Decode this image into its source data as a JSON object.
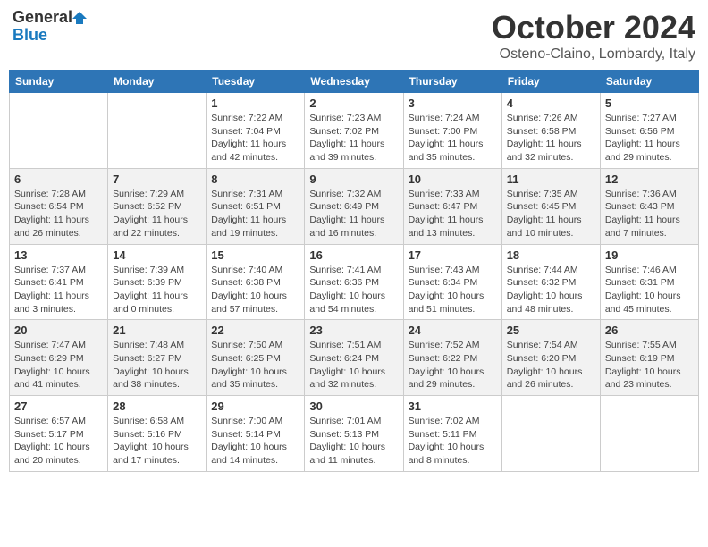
{
  "header": {
    "logo_line1": "General",
    "logo_line2": "Blue",
    "title": "October 2024",
    "location": "Osteno-Claino, Lombardy, Italy"
  },
  "days_of_week": [
    "Sunday",
    "Monday",
    "Tuesday",
    "Wednesday",
    "Thursday",
    "Friday",
    "Saturday"
  ],
  "weeks": [
    [
      {
        "day": "",
        "info": ""
      },
      {
        "day": "",
        "info": ""
      },
      {
        "day": "1",
        "info": "Sunrise: 7:22 AM\nSunset: 7:04 PM\nDaylight: 11 hours and 42 minutes."
      },
      {
        "day": "2",
        "info": "Sunrise: 7:23 AM\nSunset: 7:02 PM\nDaylight: 11 hours and 39 minutes."
      },
      {
        "day": "3",
        "info": "Sunrise: 7:24 AM\nSunset: 7:00 PM\nDaylight: 11 hours and 35 minutes."
      },
      {
        "day": "4",
        "info": "Sunrise: 7:26 AM\nSunset: 6:58 PM\nDaylight: 11 hours and 32 minutes."
      },
      {
        "day": "5",
        "info": "Sunrise: 7:27 AM\nSunset: 6:56 PM\nDaylight: 11 hours and 29 minutes."
      }
    ],
    [
      {
        "day": "6",
        "info": "Sunrise: 7:28 AM\nSunset: 6:54 PM\nDaylight: 11 hours and 26 minutes."
      },
      {
        "day": "7",
        "info": "Sunrise: 7:29 AM\nSunset: 6:52 PM\nDaylight: 11 hours and 22 minutes."
      },
      {
        "day": "8",
        "info": "Sunrise: 7:31 AM\nSunset: 6:51 PM\nDaylight: 11 hours and 19 minutes."
      },
      {
        "day": "9",
        "info": "Sunrise: 7:32 AM\nSunset: 6:49 PM\nDaylight: 11 hours and 16 minutes."
      },
      {
        "day": "10",
        "info": "Sunrise: 7:33 AM\nSunset: 6:47 PM\nDaylight: 11 hours and 13 minutes."
      },
      {
        "day": "11",
        "info": "Sunrise: 7:35 AM\nSunset: 6:45 PM\nDaylight: 11 hours and 10 minutes."
      },
      {
        "day": "12",
        "info": "Sunrise: 7:36 AM\nSunset: 6:43 PM\nDaylight: 11 hours and 7 minutes."
      }
    ],
    [
      {
        "day": "13",
        "info": "Sunrise: 7:37 AM\nSunset: 6:41 PM\nDaylight: 11 hours and 3 minutes."
      },
      {
        "day": "14",
        "info": "Sunrise: 7:39 AM\nSunset: 6:39 PM\nDaylight: 11 hours and 0 minutes."
      },
      {
        "day": "15",
        "info": "Sunrise: 7:40 AM\nSunset: 6:38 PM\nDaylight: 10 hours and 57 minutes."
      },
      {
        "day": "16",
        "info": "Sunrise: 7:41 AM\nSunset: 6:36 PM\nDaylight: 10 hours and 54 minutes."
      },
      {
        "day": "17",
        "info": "Sunrise: 7:43 AM\nSunset: 6:34 PM\nDaylight: 10 hours and 51 minutes."
      },
      {
        "day": "18",
        "info": "Sunrise: 7:44 AM\nSunset: 6:32 PM\nDaylight: 10 hours and 48 minutes."
      },
      {
        "day": "19",
        "info": "Sunrise: 7:46 AM\nSunset: 6:31 PM\nDaylight: 10 hours and 45 minutes."
      }
    ],
    [
      {
        "day": "20",
        "info": "Sunrise: 7:47 AM\nSunset: 6:29 PM\nDaylight: 10 hours and 41 minutes."
      },
      {
        "day": "21",
        "info": "Sunrise: 7:48 AM\nSunset: 6:27 PM\nDaylight: 10 hours and 38 minutes."
      },
      {
        "day": "22",
        "info": "Sunrise: 7:50 AM\nSunset: 6:25 PM\nDaylight: 10 hours and 35 minutes."
      },
      {
        "day": "23",
        "info": "Sunrise: 7:51 AM\nSunset: 6:24 PM\nDaylight: 10 hours and 32 minutes."
      },
      {
        "day": "24",
        "info": "Sunrise: 7:52 AM\nSunset: 6:22 PM\nDaylight: 10 hours and 29 minutes."
      },
      {
        "day": "25",
        "info": "Sunrise: 7:54 AM\nSunset: 6:20 PM\nDaylight: 10 hours and 26 minutes."
      },
      {
        "day": "26",
        "info": "Sunrise: 7:55 AM\nSunset: 6:19 PM\nDaylight: 10 hours and 23 minutes."
      }
    ],
    [
      {
        "day": "27",
        "info": "Sunrise: 6:57 AM\nSunset: 5:17 PM\nDaylight: 10 hours and 20 minutes."
      },
      {
        "day": "28",
        "info": "Sunrise: 6:58 AM\nSunset: 5:16 PM\nDaylight: 10 hours and 17 minutes."
      },
      {
        "day": "29",
        "info": "Sunrise: 7:00 AM\nSunset: 5:14 PM\nDaylight: 10 hours and 14 minutes."
      },
      {
        "day": "30",
        "info": "Sunrise: 7:01 AM\nSunset: 5:13 PM\nDaylight: 10 hours and 11 minutes."
      },
      {
        "day": "31",
        "info": "Sunrise: 7:02 AM\nSunset: 5:11 PM\nDaylight: 10 hours and 8 minutes."
      },
      {
        "day": "",
        "info": ""
      },
      {
        "day": "",
        "info": ""
      }
    ]
  ]
}
